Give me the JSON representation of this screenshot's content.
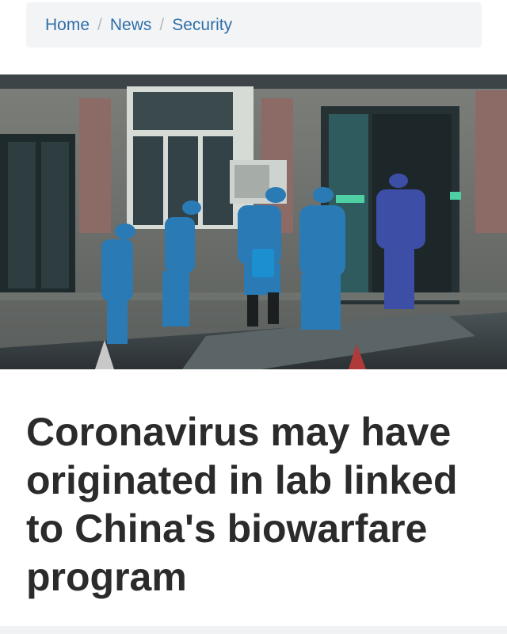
{
  "breadcrumb": {
    "items": [
      {
        "label": "Home"
      },
      {
        "label": "News"
      },
      {
        "label": "Security"
      }
    ],
    "separator": "/"
  },
  "article": {
    "headline": "Coronavirus may have originated in lab linked to China's biowarfare program"
  },
  "colors": {
    "link": "#2f6fa7",
    "headline": "#2b2b2b",
    "breadcrumb_bg": "#f3f4f6"
  }
}
